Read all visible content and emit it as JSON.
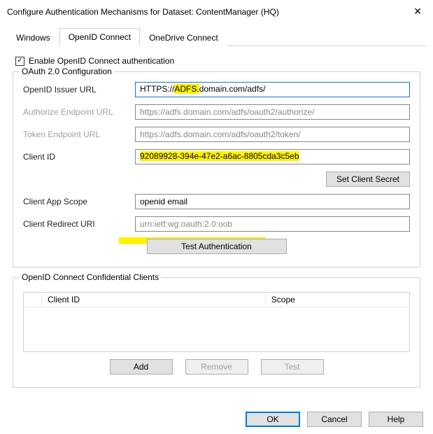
{
  "window": {
    "title": "Configure Authentication Mechanisms for Dataset: ContentManager (HQ)"
  },
  "tabs": {
    "windows": "Windows",
    "openid": "OpenID Connect",
    "onedrive": "OneDrive Connect"
  },
  "checkbox": {
    "label": "Enable OpenID Connect authentication",
    "checked_glyph": "✓"
  },
  "oauth": {
    "legend": "OAuth 2.0 Configuration",
    "issuer_label": "OpenID Issuer URL",
    "issuer_pre": "HTTPS://",
    "issuer_mark": "ADFS.",
    "issuer_post": "domain.com/adfs/",
    "issuer_full": "HTTPS://ADFS.domain.com/adfs/",
    "authorize_label": "Authorize Endpoint URL",
    "authorize_value": "https://adfs.domain.com/adfs/oauth2/authorize/",
    "token_label": "Token Endpoint URL",
    "token_value": "https://adfs.domain.com/adfs/oauth2/token/",
    "clientid_label": "Client ID",
    "clientid_value": "92089928-394e-47e2-a6ac-8805cda3c5eb",
    "set_secret_btn": "Set Client Secret",
    "scope_label": "Client App Scope",
    "scope_value": "openid email",
    "redirect_label": "Client Redirect URI",
    "redirect_value": "urn:ietf:wg:oauth:2.0:oob",
    "test_auth_btn": "Test Authentication"
  },
  "confidential": {
    "legend": "OpenID Connect Confidential Clients",
    "col_clientid": "Client ID",
    "col_scope": "Scope",
    "add_btn": "Add",
    "remove_btn": "Remove",
    "test_btn": "Test"
  },
  "footer": {
    "ok": "OK",
    "cancel": "Cancel",
    "help": "Help"
  }
}
